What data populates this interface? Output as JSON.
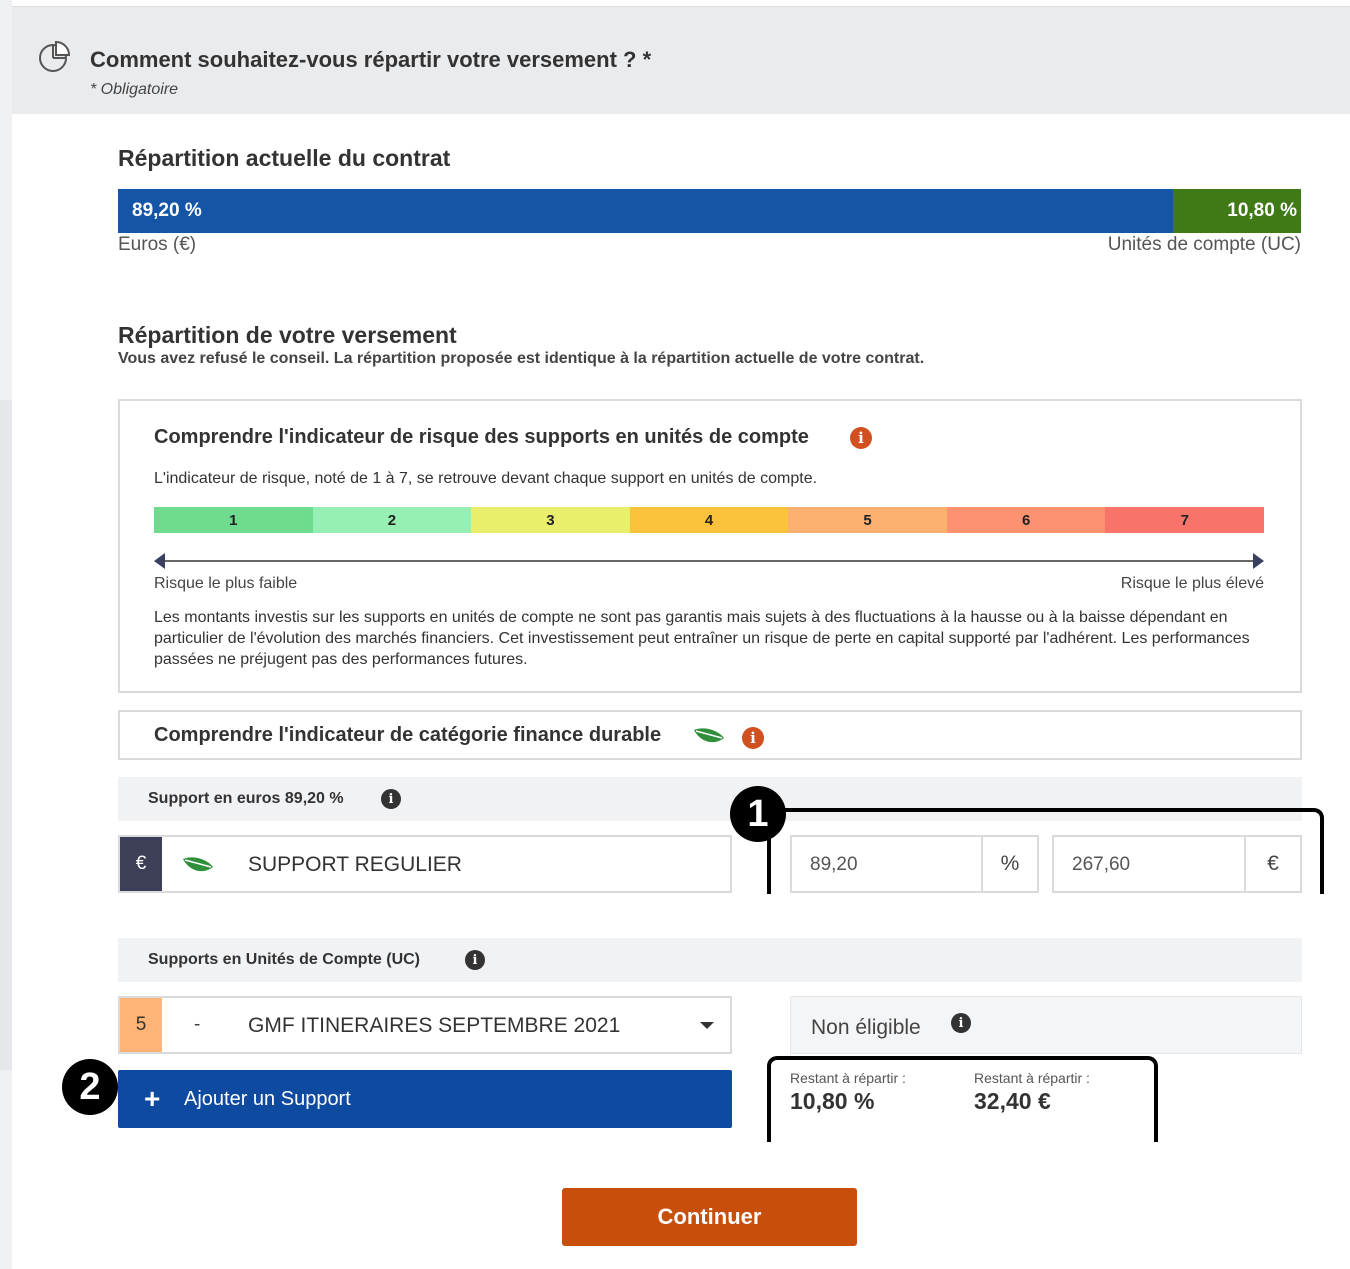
{
  "header": {
    "title": "Comment souhaitez-vous répartir votre versement ? *",
    "required_note": "* Obligatoire",
    "icon": "pie-chart-icon"
  },
  "current_allocation": {
    "title": "Répartition actuelle du contrat",
    "euro_percent_label": "89,20 %",
    "uc_percent_label": "10,80 %",
    "euro_fraction": 0.892,
    "uc_fraction": 0.108,
    "euro_label": "Euros (€)",
    "uc_label": "Unités de compte (UC)",
    "colors": {
      "euro": "#1555a5",
      "uc": "#3f7a17"
    }
  },
  "payment_allocation": {
    "title": "Répartition de votre versement",
    "subtitle": "Vous avez refusé le conseil. La répartition proposée est identique à la répartition actuelle de votre contrat."
  },
  "risk_indicator": {
    "title": "Comprendre l'indicateur de risque des supports en unités de compte",
    "description": "L'indicateur de risque, noté de 1 à 7, se retrouve devant chaque support en unités de compte.",
    "levels": [
      {
        "label": "1",
        "color": "#6fdb8f"
      },
      {
        "label": "2",
        "color": "#97f0b3"
      },
      {
        "label": "3",
        "color": "#e9ef6c"
      },
      {
        "label": "4",
        "color": "#fbc23c"
      },
      {
        "label": "5",
        "color": "#fdb170"
      },
      {
        "label": "6",
        "color": "#fd9270"
      },
      {
        "label": "7",
        "color": "#f97468"
      }
    ],
    "low_label": "Risque le plus faible",
    "high_label": "Risque le plus élevé",
    "disclaimer": "Les montants investis sur les supports en unités de compte ne sont pas garantis mais sujets à des fluctuations à la hausse ou à la baisse dépendant en particulier de l'évolution des marchés financiers. Cet investissement peut entraîner un risque de perte en capital supporté par l'adhérent. Les performances passées ne préjugent pas des performances futures."
  },
  "sustainable_indicator": {
    "title": "Comprendre l'indicateur de catégorie finance durable"
  },
  "euro_support": {
    "section_title": "Support en euros 89,20 %",
    "currency_tag": "€",
    "name": "SUPPORT REGULIER",
    "percent_value": "89,20",
    "percent_unit": "%",
    "amount_value": "267,60",
    "amount_unit": "€"
  },
  "uc_supports": {
    "section_title": "Supports en Unités de Compte (UC)",
    "risk_level": "5",
    "separator": "-",
    "selected": "GMF ITINERAIRES SEPTEMBRE 2021",
    "eligibility": "Non éligible"
  },
  "add_button": {
    "icon": "+",
    "label": "Ajouter un Support"
  },
  "remaining": {
    "percent_label": "Restant à répartir :",
    "percent_value": "10,80 %",
    "amount_label": "Restant à répartir :",
    "amount_value": "32,40 €"
  },
  "continue_button": {
    "label": "Continuer"
  },
  "info_glyph": "i",
  "markers": [
    "1",
    "2"
  ]
}
